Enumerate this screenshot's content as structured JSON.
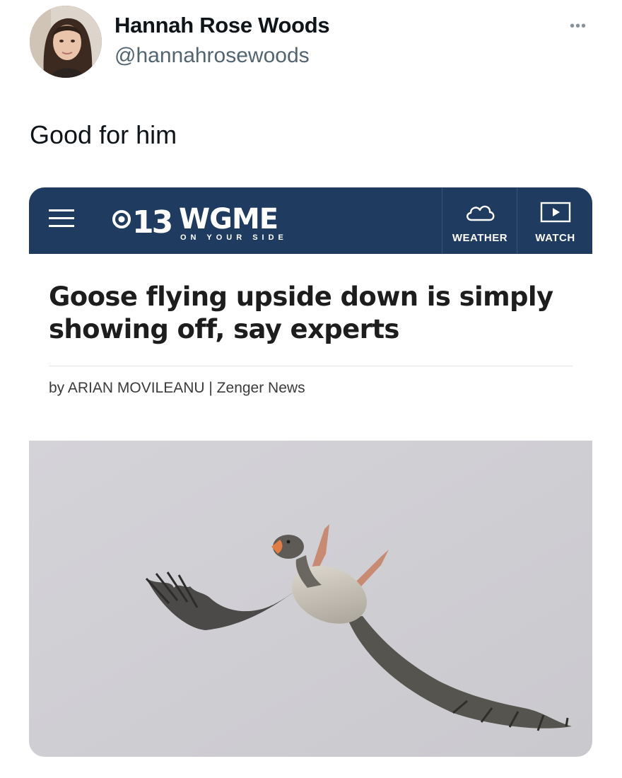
{
  "user": {
    "display_name": "Hannah Rose Woods",
    "handle": "@hannahrosewoods",
    "avatar_icon": "profile-photo"
  },
  "menu": {
    "more_label": "•••"
  },
  "tweet": {
    "text": "Good for him"
  },
  "news_card": {
    "header_bg": "#1f3c60",
    "logo": {
      "number": "13",
      "callsign": "WGME",
      "tagline": "ON YOUR SIDE"
    },
    "nav": {
      "menu_icon": "hamburger-icon",
      "weather_label": "WEATHER",
      "watch_label": "WATCH"
    },
    "headline": "Goose flying upside down is simply showing off, say experts",
    "byline": "by ARIAN MOVILEANU | Zenger News"
  }
}
